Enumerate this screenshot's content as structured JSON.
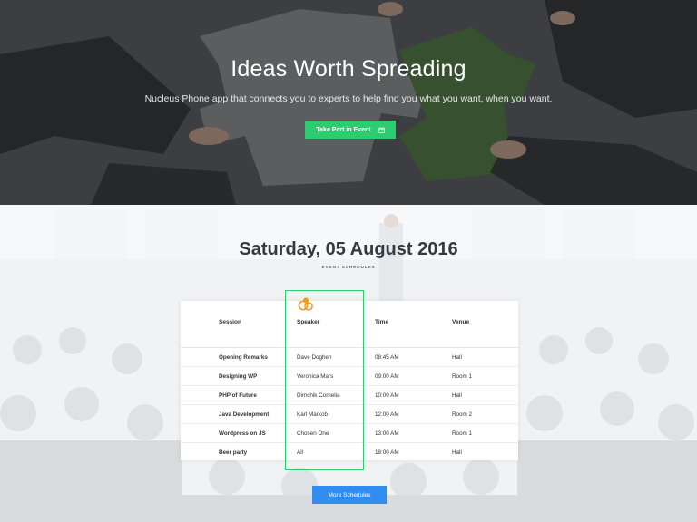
{
  "hero": {
    "title": "Ideas Worth Spreading",
    "subtitle": "Nucleus Phone app that connects you to experts to help find you what you want, when you want.",
    "button_label": "Take Part in Event",
    "button_icon": "calendar-icon",
    "accent_color": "#2ecc71"
  },
  "schedule": {
    "date_title": "Saturday, 05 August 2016",
    "subtitle": "EVENT SCHEDULES",
    "columns": [
      "Session",
      "Speaker",
      "Time",
      "Venue"
    ],
    "rows": [
      [
        "Opening Remarks",
        "Dave Doghen",
        "08:45 AM",
        "Hall"
      ],
      [
        "Designing WP",
        "Veronica Mars",
        "09:00 AM",
        "Room 1"
      ],
      [
        "PHP of Future",
        "Dimchik Cornelia",
        "10:00 AM",
        "Hall"
      ],
      [
        "Java Development",
        "Karl Markob",
        "12:00 AM",
        "Room 2"
      ],
      [
        "Wordpress on JS",
        "Chosen One",
        "13:00 AM",
        "Room 1"
      ],
      [
        "Beer party",
        "All",
        "18:00 AM",
        "Hall"
      ]
    ],
    "highlight_icon": "speakers-icon",
    "more_button_label": "More Schedules",
    "more_button_color": "#2f8cf0"
  }
}
